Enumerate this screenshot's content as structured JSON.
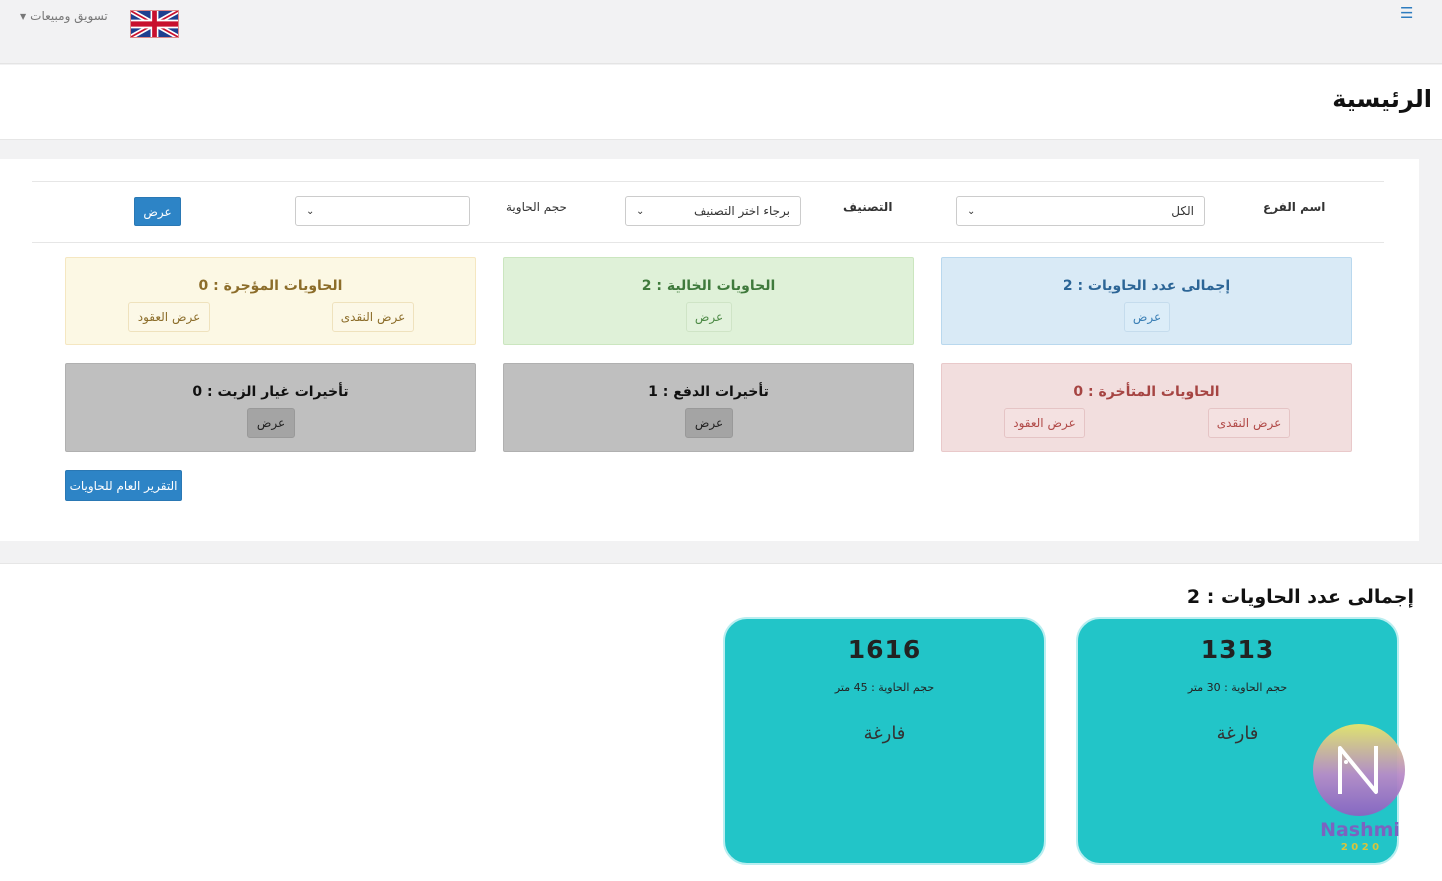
{
  "topbar": {
    "menu_icon": "hamburger-icon",
    "user_menu_label": "تسويق ومبيعات",
    "language_flag": "uk-flag-icon"
  },
  "page_title": "الرئيسية",
  "filters": {
    "branch_label": "اسم الفرع",
    "branch_value": "الكل",
    "category_label": "التصنيف",
    "category_value": "برجاء اختر التصنيف",
    "size_label": "حجم الحاوية",
    "size_value": "",
    "show_button": "عرض"
  },
  "summary_cards": {
    "total": {
      "title": "إجمالى عدد الحاويات : 2",
      "button": "عرض"
    },
    "empty": {
      "title": "الحاويات الخالية : 2",
      "button": "عرض"
    },
    "rented": {
      "title": "الحاويات المؤجرة : 0",
      "cash_button": "عرض النقدى",
      "contracts_button": "عرض العقود"
    },
    "late": {
      "title": "الحاويات المتأخرة : 0",
      "cash_button": "عرض النقدى",
      "contracts_button": "عرض العقود"
    },
    "payment_delays": {
      "title": "تأخيرات الدفع : 1",
      "button": "عرض"
    },
    "oil_delays": {
      "title": "تأخيرات غيار الزيت : 0",
      "button": "عرض"
    }
  },
  "general_report_button": "التقرير العام للحاويات",
  "containers_section": {
    "title": "إجمالى عدد الحاويات : 2",
    "containers": [
      {
        "number": "1313",
        "size": "حجم الحاوية : 30 متر",
        "status": "فارغة"
      },
      {
        "number": "1616",
        "size": "حجم الحاوية : 45 متر",
        "status": "فارغة"
      }
    ]
  },
  "watermark": {
    "text": "Nashmi",
    "subtext": "2 0 2 0"
  },
  "colors": {
    "primary": "#2d84c6",
    "tile": "#22c5c8",
    "info": "#d9eaf6",
    "success": "#dff1d8",
    "warning": "#fcf8e4",
    "danger": "#f2dede",
    "neutral": "#bfbfbf"
  }
}
